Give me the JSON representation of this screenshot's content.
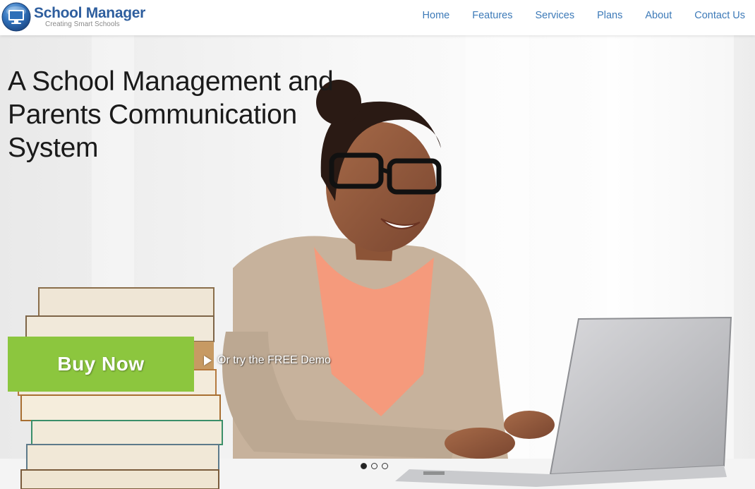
{
  "brand": {
    "name": "School Manager",
    "tagline": "Creating Smart Schools",
    "logo_icon": "monitor-icon"
  },
  "nav": {
    "items": [
      {
        "label": "Home"
      },
      {
        "label": "Features"
      },
      {
        "label": "Services"
      },
      {
        "label": "Plans"
      },
      {
        "label": "About"
      },
      {
        "label": "Contact Us"
      }
    ]
  },
  "hero": {
    "headline": "A School Management and Parents Communication System",
    "cta_label": "Buy Now",
    "demo_label": "Or try the FREE Demo",
    "slide_count": 3,
    "active_slide": 1
  },
  "colors": {
    "brand_blue": "#2e5e9e",
    "nav_link": "#3d7ab8",
    "cta_green": "#8cc63e"
  }
}
